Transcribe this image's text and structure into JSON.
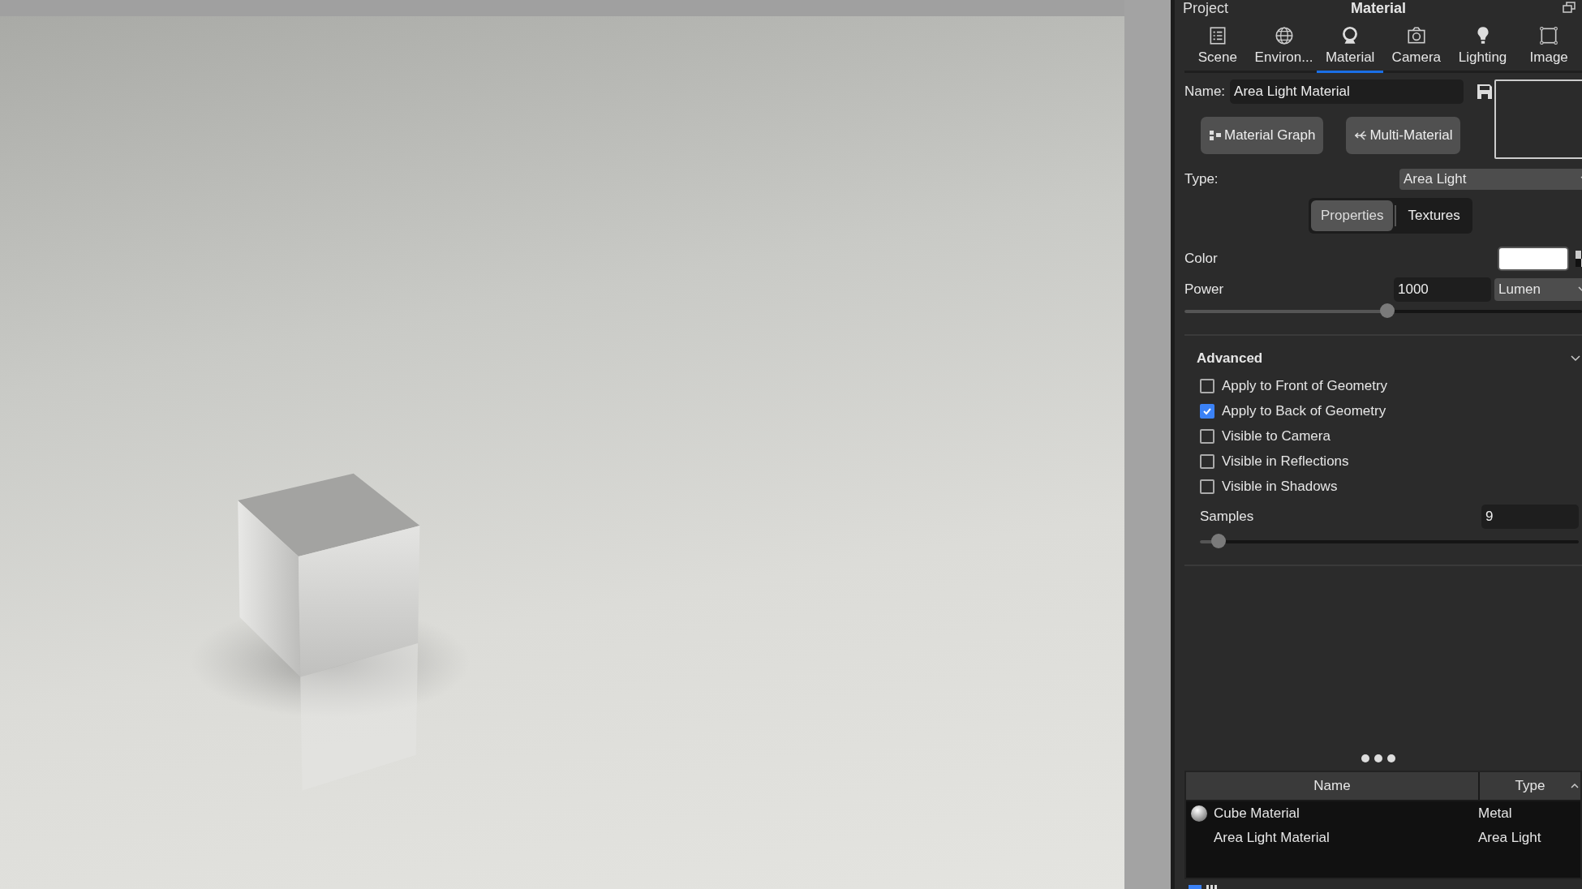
{
  "header": {
    "section": "Project",
    "title": "Material"
  },
  "tabs": [
    {
      "label": "Scene",
      "selected": false
    },
    {
      "label": "Environ...",
      "selected": false
    },
    {
      "label": "Material",
      "selected": true
    },
    {
      "label": "Camera",
      "selected": false
    },
    {
      "label": "Lighting",
      "selected": false
    },
    {
      "label": "Image",
      "selected": false
    }
  ],
  "name_field": {
    "label": "Name:",
    "value": "Area Light Material"
  },
  "buttons": [
    {
      "label": "Material Graph"
    },
    {
      "label": "Multi-Material"
    }
  ],
  "type_field": {
    "label": "Type:",
    "value": "Area Light"
  },
  "subtabs": [
    {
      "label": "Properties",
      "selected": true
    },
    {
      "label": "Textures",
      "selected": false
    }
  ],
  "color_field": {
    "label": "Color"
  },
  "power": {
    "label": "Power",
    "value": "1000",
    "unit": "Lumen",
    "level": 0.51
  },
  "advanced": {
    "title": "Advanced",
    "expanded": true,
    "options": [
      {
        "label": "Apply to Front of Geometry",
        "checked": false
      },
      {
        "label": "Apply to Back of Geometry",
        "checked": true
      },
      {
        "label": "Visible to Camera",
        "checked": false
      },
      {
        "label": "Visible in Reflections",
        "checked": false
      },
      {
        "label": "Visible in Shadows",
        "checked": false
      }
    ],
    "samples": {
      "label": "Samples",
      "value": "9",
      "level": 0.05
    }
  },
  "materials_table": {
    "columns": [
      "Name",
      "Type"
    ],
    "rows": [
      {
        "name": "Cube Material",
        "type": "Metal",
        "has_preview": true
      },
      {
        "name": "Area Light Material",
        "type": "Area Light",
        "has_preview": false
      }
    ]
  }
}
